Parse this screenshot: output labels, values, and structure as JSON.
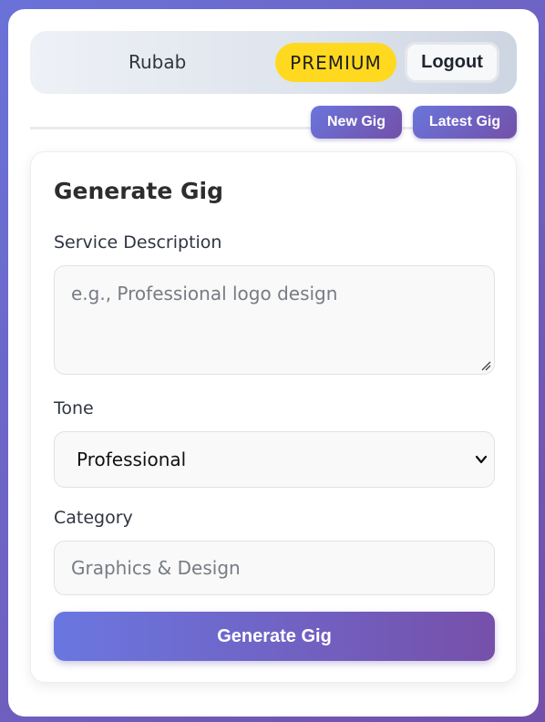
{
  "header": {
    "username": "Rubab",
    "badge": "PREMIUM",
    "logout_label": "Logout"
  },
  "nav": {
    "new_gig_label": "New Gig",
    "latest_gig_label": "Latest Gig"
  },
  "form": {
    "title": "Generate Gig",
    "description": {
      "label": "Service Description",
      "placeholder": "e.g., Professional logo design",
      "value": ""
    },
    "tone": {
      "label": "Tone",
      "selected": "Professional"
    },
    "category": {
      "label": "Category",
      "placeholder": "Graphics & Design",
      "value": ""
    },
    "submit_label": "Generate Gig"
  },
  "colors": {
    "background_gradient_start": "#6a72d8",
    "background_gradient_end": "#7250aa",
    "premium_badge": "#ffd91f",
    "button_gradient_start": "#6a77e0",
    "button_gradient_end": "#7650aa"
  },
  "icons": {
    "select_arrow": "chevron-down-icon",
    "textarea_resize": "resize-grip-icon"
  }
}
